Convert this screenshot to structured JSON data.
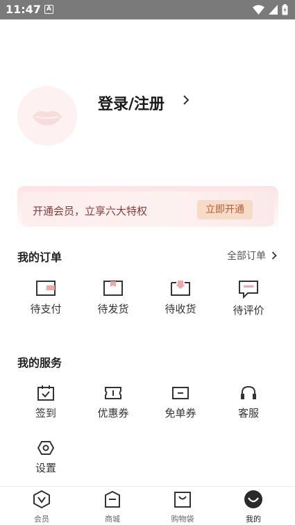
{
  "status_bar": {
    "time": "11:47",
    "a_badge": "A"
  },
  "login": {
    "label": "登录/注册"
  },
  "vip_banner": {
    "text": "开通会员，立享六大特权",
    "button": "立即开通"
  },
  "orders": {
    "title": "我的订单",
    "all_link": "全部订单",
    "items": [
      {
        "label": "待支付",
        "icon": "wallet-icon"
      },
      {
        "label": "待发货",
        "icon": "box-icon"
      },
      {
        "label": "待收货",
        "icon": "inbox-icon"
      },
      {
        "label": "待评价",
        "icon": "comment-icon"
      }
    ]
  },
  "services": {
    "title": "我的服务",
    "items": [
      {
        "label": "签到",
        "icon": "calendar-icon"
      },
      {
        "label": "优惠券",
        "icon": "coupon-icon"
      },
      {
        "label": "免单券",
        "icon": "voucher-icon"
      },
      {
        "label": "客服",
        "icon": "headset-icon"
      },
      {
        "label": "设置",
        "icon": "settings-icon"
      }
    ]
  },
  "tabbar": {
    "items": [
      {
        "label": "会员",
        "icon": "vip-icon"
      },
      {
        "label": "商城",
        "icon": "store-icon"
      },
      {
        "label": "购物袋",
        "icon": "bag-icon"
      },
      {
        "label": "我的",
        "icon": "profile-icon"
      }
    ],
    "active_index": 3
  },
  "colors": {
    "accent": "#f07b7b",
    "vip_text": "#8a3b3b",
    "vip_button_bg": "#f6dcc6"
  }
}
